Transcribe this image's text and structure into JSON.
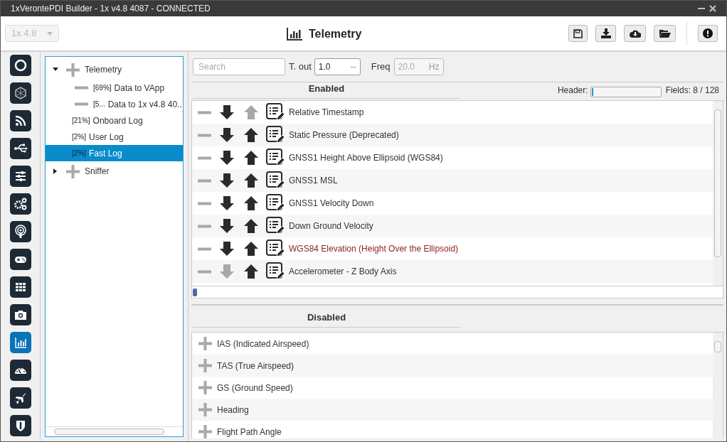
{
  "window": {
    "title": "1xVerontePDI Builder - 1x v4.8 4087 - CONNECTED"
  },
  "toolbar": {
    "version": {
      "value": "1x 4.8",
      "disabled": true
    },
    "title": "Telemetry"
  },
  "sidebar": {
    "items": [
      {
        "selected": false
      },
      {
        "selected": false
      },
      {
        "selected": false
      },
      {
        "selected": false
      },
      {
        "selected": false
      },
      {
        "selected": false
      },
      {
        "selected": false
      },
      {
        "selected": false
      },
      {
        "selected": false
      },
      {
        "selected": false
      },
      {
        "selected": true
      },
      {
        "selected": false
      },
      {
        "selected": false
      },
      {
        "selected": false
      }
    ]
  },
  "tree": {
    "items": [
      {
        "label": "Telemetry",
        "kind": "group",
        "expanded": true,
        "selected": false,
        "children": [
          {
            "tag": "[69%]",
            "label": "Data to VApp",
            "kind": "stream",
            "selected": false
          },
          {
            "tag": "[5...",
            "label": "Data to 1x v4.8 40..",
            "kind": "stream",
            "selected": false
          },
          {
            "tag": "[21%]",
            "label": "Onboard Log",
            "kind": "log",
            "selected": false
          },
          {
            "tag": "[2%]",
            "label": "User Log",
            "kind": "log",
            "selected": false
          },
          {
            "tag": "[2%]",
            "label": "Fast Log",
            "kind": "log",
            "selected": true
          }
        ]
      },
      {
        "label": "Sniffer",
        "kind": "group",
        "expanded": false,
        "selected": false
      }
    ]
  },
  "filters": {
    "search": {
      "placeholder": "Search"
    },
    "timeout": {
      "label": "T. out",
      "value": "1.0",
      "unit": "--",
      "disabled": false
    },
    "freq": {
      "label": "Freq",
      "value": "20.0",
      "unit": "Hz",
      "disabled": true
    }
  },
  "enabled": {
    "title": "Enabled",
    "header_label": "Header:",
    "header_bar": {
      "level": 0.02
    },
    "fields": "Fields: 8 / 128",
    "rows": [
      {
        "name": "Relative Timestamp",
        "down_enabled": true,
        "up_enabled": false,
        "warning": false
      },
      {
        "name": "Static Pressure (Deprecated)",
        "down_enabled": true,
        "up_enabled": true,
        "warning": false
      },
      {
        "name": "GNSS1 Height Above Ellipsoid (WGS84)",
        "down_enabled": true,
        "up_enabled": true,
        "warning": false
      },
      {
        "name": "GNSS1 MSL",
        "down_enabled": true,
        "up_enabled": true,
        "warning": false
      },
      {
        "name": "GNSS1 Velocity Down",
        "down_enabled": true,
        "up_enabled": true,
        "warning": false
      },
      {
        "name": "Down Ground Velocity",
        "down_enabled": true,
        "up_enabled": true,
        "warning": false
      },
      {
        "name": "WGS84 Elevation (Height Over the Ellipsoid)",
        "down_enabled": true,
        "up_enabled": true,
        "warning": true
      },
      {
        "name": "Accelerometer - Z Body Axis",
        "down_enabled": false,
        "up_enabled": true,
        "warning": false
      }
    ]
  },
  "disabled": {
    "title": "Disabled",
    "rows": [
      {
        "name": "IAS (Indicated Airspeed)"
      },
      {
        "name": "TAS (True Airspeed)"
      },
      {
        "name": "GS (Ground Speed)"
      },
      {
        "name": "Heading"
      },
      {
        "name": "Flight Path Angle"
      }
    ]
  }
}
